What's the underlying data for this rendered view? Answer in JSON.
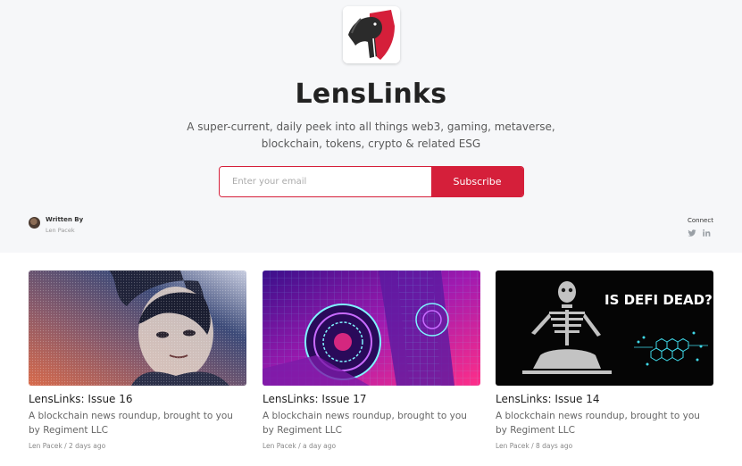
{
  "site": {
    "title": "LensLinks",
    "tagline": "A super-current, daily peek into all things web3, gaming, metaverse, blockchain, tokens, crypto & related ESG",
    "logo_icon": "horse-shield-logo"
  },
  "subscribe": {
    "placeholder": "Enter your email",
    "button_label": "Subscribe"
  },
  "author": {
    "heading": "Written By",
    "name": "Len Pacek"
  },
  "connect": {
    "heading": "Connect",
    "icons": [
      "twitter-icon",
      "linkedin-icon"
    ]
  },
  "posts": [
    {
      "title": "LensLinks: Issue 16",
      "excerpt": "A blockchain news roundup, brought to you by Regiment LLC",
      "author": "Len Pacek",
      "separator": "/",
      "date": "2 days ago"
    },
    {
      "title": "LensLinks: Issue 17",
      "excerpt": "A blockchain news roundup, brought to you by Regiment LLC",
      "author": "Len Pacek",
      "separator": "/",
      "date": "a day ago"
    },
    {
      "title": "LensLinks: Issue 14",
      "excerpt": "A blockchain news roundup, brought to you by Regiment LLC",
      "author": "Len Pacek",
      "separator": "/",
      "date": "8 days ago",
      "image_text": "IS DEFI DEAD?"
    }
  ],
  "colors": {
    "accent": "#d51f3a",
    "hero_background": "#f6f7f9",
    "text_dark": "#222222",
    "text_muted": "#666666"
  }
}
